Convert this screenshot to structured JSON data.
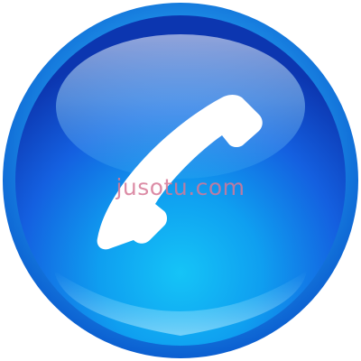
{
  "button": {
    "icon": "phone-handset-icon",
    "base_color": "#1f74e8",
    "dark_edge_color": "#0b3fb6",
    "highlight_color": "#7fd0fb",
    "glyph_color": "#ffffff"
  },
  "watermark": {
    "text": "jusotu.com"
  }
}
